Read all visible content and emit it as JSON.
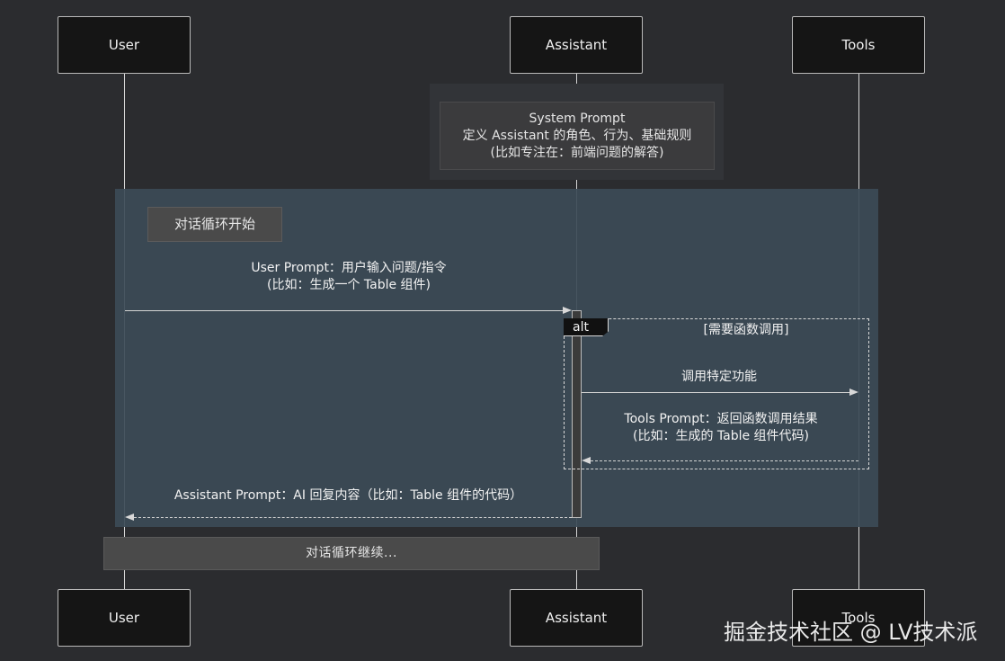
{
  "participants": {
    "user": "User",
    "assistant": "Assistant",
    "tools": "Tools"
  },
  "system_note": {
    "line1": "System Prompt",
    "line2": "定义 Assistant 的角色、行为、基础规则",
    "line3": "(比如专注在：前端问题的解答)"
  },
  "loop": {
    "start_label": "对话循环开始",
    "continue_label": "对话循环继续..."
  },
  "messages": {
    "user_prompt_line1": "User Prompt：用户输入问题/指令",
    "user_prompt_line2": "(比如：生成一个 Table 组件)",
    "call_tool": "调用特定功能",
    "tools_prompt_line1": "Tools Prompt：返回函数调用结果",
    "tools_prompt_line2": "(比如：生成的 Table 组件代码)",
    "assistant_reply": "Assistant Prompt：AI 回复内容（比如：Table 组件的代码）"
  },
  "alt": {
    "label": "alt",
    "condition": "[需要函数调用]"
  },
  "watermark": "掘金技术社区 @ LV技术派"
}
